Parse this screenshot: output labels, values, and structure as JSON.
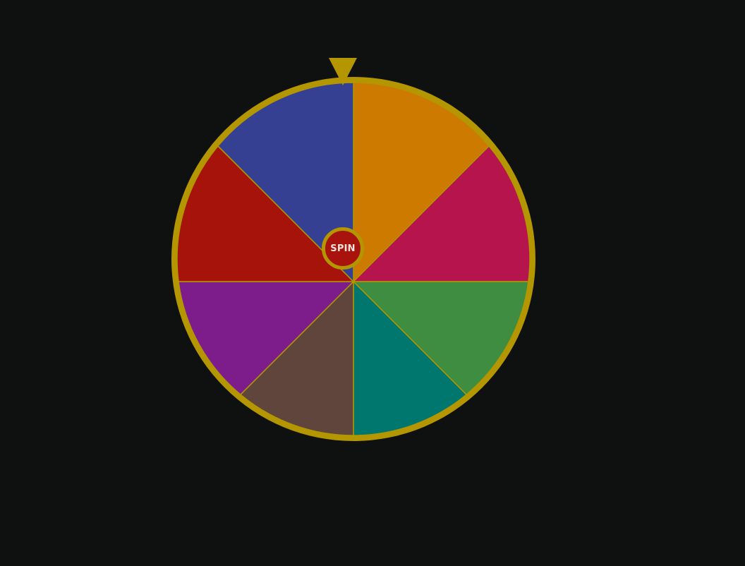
{
  "wheel": {
    "spin_label": "SPIN",
    "rim_color": "#b39600",
    "divider_color": "#b39600",
    "pointer_color": "#b39600",
    "hub_color": "#a8140d",
    "hub_text_color": "#f3e3d8",
    "background_color": "#0f1010",
    "segments": [
      {
        "name": "segment-orange",
        "color": "#cc7a00"
      },
      {
        "name": "segment-crimson",
        "color": "#b5154c"
      },
      {
        "name": "segment-green",
        "color": "#3e8d40"
      },
      {
        "name": "segment-teal",
        "color": "#00776e"
      },
      {
        "name": "segment-brown",
        "color": "#5f453b"
      },
      {
        "name": "segment-purple",
        "color": "#7d1d8c"
      },
      {
        "name": "segment-red",
        "color": "#a6130b"
      },
      {
        "name": "segment-indigo",
        "color": "#354092"
      }
    ]
  }
}
